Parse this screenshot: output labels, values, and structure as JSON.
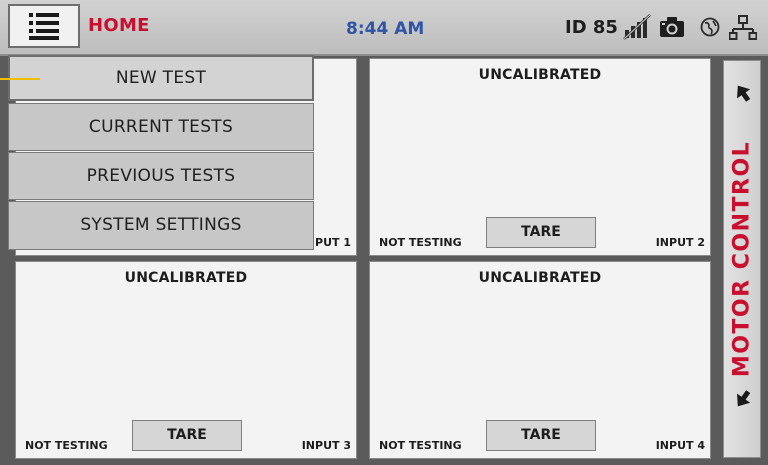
{
  "header": {
    "title": "HOME",
    "time": "8:44 AM",
    "device_id": "ID 85",
    "icons": [
      "menu-icon",
      "signal-off-icon",
      "camera-icon",
      "globe-icon",
      "network-icon"
    ]
  },
  "menu": {
    "items": [
      {
        "label": "NEW TEST"
      },
      {
        "label": "CURRENT TESTS"
      },
      {
        "label": "PREVIOUS TESTS"
      },
      {
        "label": "SYSTEM SETTINGS"
      }
    ]
  },
  "panels": [
    {
      "status": "",
      "test_state": "",
      "tare_label": "",
      "input_label": "PUT 1"
    },
    {
      "status": "UNCALIBRATED",
      "test_state": "NOT TESTING",
      "tare_label": "TARE",
      "input_label": "INPUT 2"
    },
    {
      "status": "UNCALIBRATED",
      "test_state": "NOT TESTING",
      "tare_label": "TARE",
      "input_label": "INPUT 3"
    },
    {
      "status": "UNCALIBRATED",
      "test_state": "NOT TESTING",
      "tare_label": "TARE",
      "input_label": "INPUT 4"
    }
  ],
  "motor_control": {
    "label": "MOTOR CONTROL",
    "icons": [
      "arrow-up-icon",
      "arrow-down-icon"
    ]
  },
  "colors": {
    "accent_red": "#c8102e",
    "clock_blue": "#2f55a4",
    "pointer_yellow": "#f0c000"
  }
}
